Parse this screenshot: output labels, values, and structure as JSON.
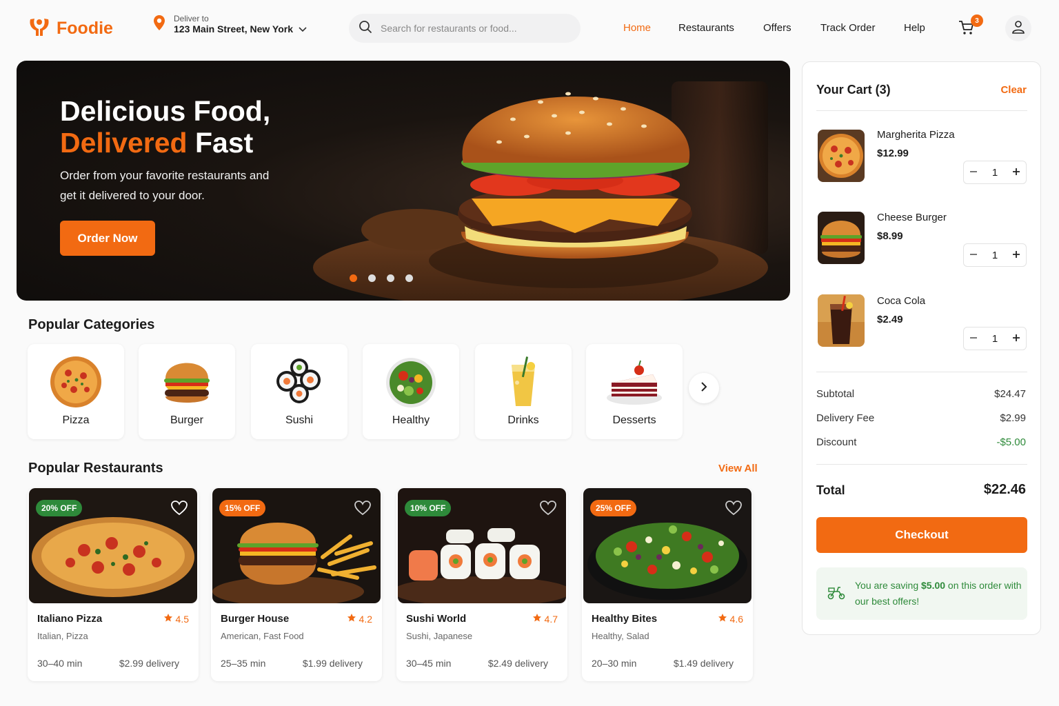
{
  "brand": {
    "name": "Foodie",
    "accent": "#f26a12"
  },
  "location": {
    "label": "Deliver to",
    "address": "123 Main Street, New York"
  },
  "search": {
    "placeholder": "Search for restaurants or food..."
  },
  "nav": {
    "items": [
      "Home",
      "Restaurants",
      "Offers",
      "Track Order",
      "Help"
    ],
    "active": "Home"
  },
  "cart_badge": "3",
  "hero": {
    "title_line1": "Delicious Food,",
    "title_highlight": "Delivered",
    "title_rest": " Fast",
    "subtitle": "Order from your favorite restaurants and get it delivered to your door.",
    "cta": "Order Now",
    "slides": 4,
    "active_slide": 1
  },
  "categories": {
    "title": "Popular Categories",
    "items": [
      "Pizza",
      "Burger",
      "Sushi",
      "Healthy",
      "Drinks",
      "Desserts"
    ]
  },
  "restaurants": {
    "title": "Popular Restaurants",
    "view_all": "View All",
    "items": [
      {
        "discount": "20% OFF",
        "badge_color": "#2e8a3a",
        "name": "Italiano Pizza",
        "rating": "4.5",
        "cuisine": "Italian, Pizza",
        "time": "30–40 min",
        "fee": "$2.99 delivery"
      },
      {
        "discount": "15% OFF",
        "badge_color": "#f26a12",
        "name": "Burger House",
        "rating": "4.2",
        "cuisine": "American, Fast Food",
        "time": "25–35 min",
        "fee": "$1.99 delivery"
      },
      {
        "discount": "10% OFF",
        "badge_color": "#2e8a3a",
        "name": "Sushi World",
        "rating": "4.7",
        "cuisine": "Sushi, Japanese",
        "time": "30–45 min",
        "fee": "$2.49 delivery"
      },
      {
        "discount": "25% OFF",
        "badge_color": "#f26a12",
        "name": "Healthy Bites",
        "rating": "4.6",
        "cuisine": "Healthy, Salad",
        "time": "20–30 min",
        "fee": "$1.49 delivery"
      }
    ]
  },
  "cart": {
    "title": "Your Cart (3)",
    "clear": "Clear",
    "items": [
      {
        "name": "Margherita Pizza",
        "price": "$12.99",
        "qty": "1"
      },
      {
        "name": "Cheese Burger",
        "price": "$8.99",
        "qty": "1"
      },
      {
        "name": "Coca Cola",
        "price": "$2.49",
        "qty": "1"
      }
    ],
    "subtotal_label": "Subtotal",
    "subtotal": "$24.47",
    "delivery_label": "Delivery Fee",
    "delivery": "$2.99",
    "discount_label": "Discount",
    "discount": "-$5.00",
    "total_label": "Total",
    "total": "$22.46",
    "checkout": "Checkout",
    "saving_pre": "You are saving ",
    "saving_amount": "$5.00",
    "saving_post": " on this order with our best offers!"
  }
}
